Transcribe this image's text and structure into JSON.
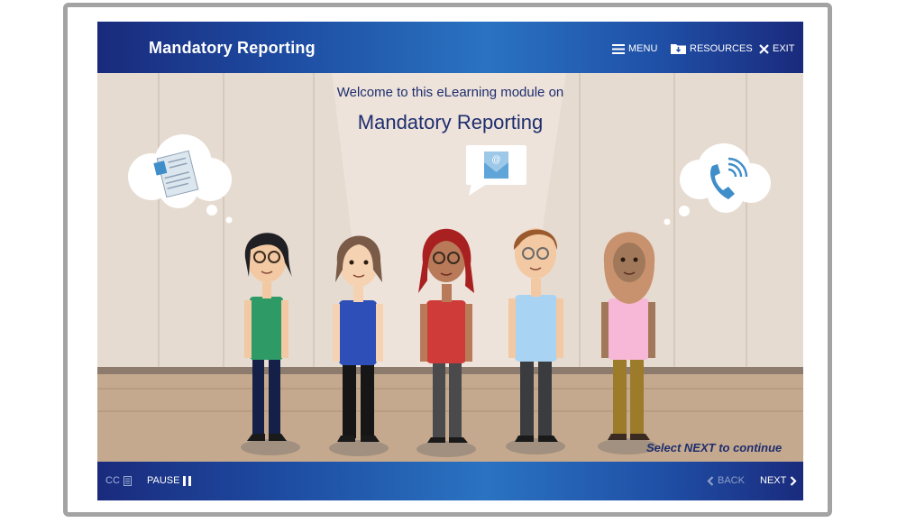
{
  "header": {
    "title": "Mandatory Reporting",
    "menu_label": "MENU",
    "resources_label": "RESOURCES",
    "exit_label": "EXIT"
  },
  "slide": {
    "welcome_text": "Welcome to this eLearning module on",
    "module_title": "Mandatory Reporting",
    "hint": "Select NEXT to continue"
  },
  "footer": {
    "cc_label": "CC",
    "pause_label": "PAUSE",
    "back_label": "BACK",
    "next_label": "NEXT"
  },
  "icons": {
    "menu": "hamburger-icon",
    "resources": "folder-download-icon",
    "exit": "close-icon",
    "cc": "transcript-icon",
    "pause": "pause-icon",
    "back": "chevron-left-icon",
    "next": "chevron-right-icon"
  },
  "colors": {
    "bar_dark": "#1a2a7c",
    "bar_light": "#2a73c2",
    "title_text": "#1e2d6e",
    "back_disabled": "#8da0c8"
  }
}
